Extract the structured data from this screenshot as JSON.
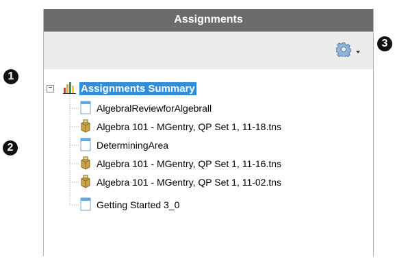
{
  "callouts": [
    "1",
    "2",
    "3"
  ],
  "panel": {
    "title": "Assignments",
    "toolbar": {
      "settings_icon": "gear-icon",
      "menu_icon": "chevron-down-icon"
    }
  },
  "tree": {
    "root": {
      "label": "Assignments Summary",
      "expander": "−",
      "icon": "bar-chart-icon",
      "selected": true
    },
    "items": [
      {
        "label": "AlgebralReviewforAlgebrall",
        "icon": "document-icon"
      },
      {
        "label": "Algebra 101 - MGentry, QP Set 1, 11-18.tns",
        "icon": "package-icon"
      },
      {
        "label": "DeterminingArea",
        "icon": "document-icon"
      },
      {
        "label": "Algebra 101 - MGentry, QP Set 1, 11-16.tns",
        "icon": "package-icon"
      },
      {
        "label": "Algebra 101 - MGentry, QP Set 1, 11-02.tns",
        "icon": "package-icon"
      },
      {
        "label": "Getting Started 3_0",
        "icon": "document-icon"
      }
    ]
  },
  "colors": {
    "header_bg": "#6b6b6b",
    "toolbar_bg": "#ececec",
    "selection": "#2f8ddc"
  }
}
